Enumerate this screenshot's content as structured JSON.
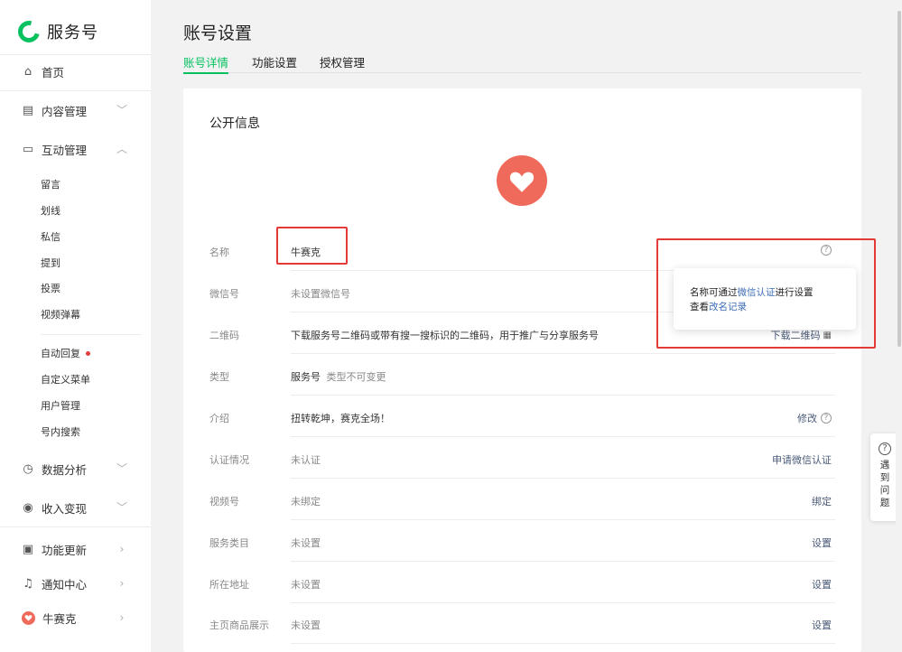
{
  "app": {
    "logo_text": "服务号(",
    "brand_color": "#07c160",
    "highlight_color": "#e53935"
  },
  "sidebar": {
    "home": {
      "label": "首页",
      "icon": "home-icon"
    },
    "content": {
      "label": "内容管理",
      "icon": "document-icon"
    },
    "interaction": {
      "label": "互动管理",
      "icon": "chat-icon"
    },
    "interaction_sub": [
      "留言",
      "划线",
      "私信",
      "提到",
      "投票",
      "视频弹幕"
    ],
    "interaction_sub2": [
      "自动回复",
      "自定义菜单",
      "用户管理",
      "号内搜索"
    ],
    "analytics": {
      "label": "数据分析",
      "icon": "chart-icon"
    },
    "monetize": {
      "label": "收入变现",
      "icon": "coin-icon"
    },
    "updates": {
      "label": "功能更新",
      "icon": "update-icon"
    },
    "notifications": {
      "label": "通知中心",
      "icon": "bell-icon"
    },
    "account": {
      "label": "牛赛克",
      "icon": "heart-avatar-icon"
    }
  },
  "header": {
    "title": "账号设置",
    "tabs": [
      "账号详情",
      "功能设置",
      "授权管理"
    ],
    "active_tab": "账号详情"
  },
  "card": {
    "section_title": "公开信息",
    "rows": [
      {
        "label": "名称",
        "value": "牛赛克",
        "value_muted": false,
        "action": ""
      },
      {
        "label": "微信号",
        "value": "未设置微信号",
        "value_muted": true,
        "action": ""
      },
      {
        "label": "二维码",
        "value": "下载服务号二维码或带有搜一搜标识的二维码，用于推广与分享服务号",
        "value_muted": false,
        "action": "下载二维码"
      },
      {
        "label": "类型",
        "value": "服务号",
        "value_suffix": "类型不可变更",
        "value_muted": false,
        "action": ""
      },
      {
        "label": "介绍",
        "value": "扭转乾坤，赛克全场！",
        "value_muted": false,
        "action": "修改"
      },
      {
        "label": "认证情况",
        "value": "未认证",
        "value_muted": true,
        "action": "申请微信认证"
      },
      {
        "label": "视频号",
        "value": "未绑定",
        "value_muted": true,
        "action": "绑定"
      },
      {
        "label": "服务类目",
        "value": "未设置",
        "value_muted": true,
        "action": "设置"
      },
      {
        "label": "所在地址",
        "value": "未设置",
        "value_muted": true,
        "action": "设置"
      },
      {
        "label": "主页商品展示",
        "value": "未设置",
        "value_muted": true,
        "action": "设置"
      }
    ]
  },
  "popover": {
    "line1_prefix": "名称可通过",
    "line1_link": "微信认证",
    "line1_suffix": "进行设置",
    "line2_prefix": "查看",
    "line2_link": "改名记录"
  },
  "help_float": {
    "label": "遇到问题"
  }
}
